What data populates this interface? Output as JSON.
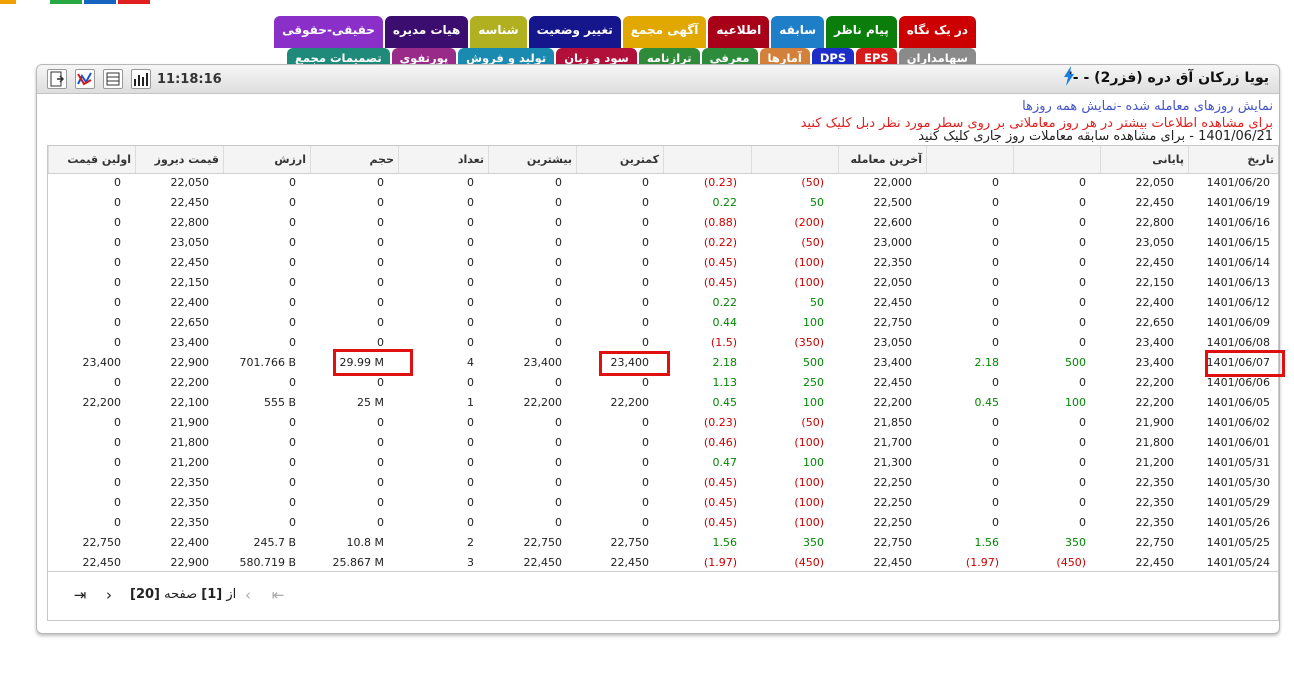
{
  "top_strip_colors": [
    "#f0a000",
    "#28a745",
    "#1565c0",
    "#e02020"
  ],
  "tabs_row1": [
    {
      "label": "در یک نگاه",
      "color": "#cc0000"
    },
    {
      "label": "پیام ناظر",
      "color": "#0a7d0a"
    },
    {
      "label": "سابقه",
      "color": "#1e7fc8"
    },
    {
      "label": "اطلاعیه",
      "color": "#a80018"
    },
    {
      "label": "آگهی مجمع",
      "color": "#e0a800"
    },
    {
      "label": "تغییر وضعیت",
      "color": "#16168c"
    },
    {
      "label": "شناسه",
      "color": "#b0b020"
    },
    {
      "label": "هیات مدیره",
      "color": "#3a0d6e"
    },
    {
      "label": "حقیقی-حقوقی",
      "color": "#8b2fc9"
    }
  ],
  "tabs_row2": [
    {
      "label": "سهامداران",
      "color": "#8a8a8a"
    },
    {
      "label": "EPS",
      "color": "#d61a1a"
    },
    {
      "label": "DPS",
      "color": "#1d2ec8"
    },
    {
      "label": "آمارها",
      "color": "#d2803a"
    },
    {
      "label": "معرفی",
      "color": "#2c8c3c"
    },
    {
      "label": "ترازنامه",
      "color": "#2f8a3a"
    },
    {
      "label": "سود و زیان",
      "color": "#b0103a"
    },
    {
      "label": "تولید و فروش",
      "color": "#1a8ab0"
    },
    {
      "label": "پورتفوی",
      "color": "#9a2a8a"
    },
    {
      "label": "تصمیمات مجمع",
      "color": "#1f8a7a"
    }
  ],
  "panel": {
    "title": "یویا زرکان آق دره (فزر2) - -'",
    "time": "11:18:16"
  },
  "info": {
    "line1": "نمایش روزهای معامله شده -نمایش همه روزها",
    "line2": "برای مشاهده اطلاعات بیشتر در هر روز معاملاتی بر روی سطر مورد نظر دبل کلیک کنید",
    "line3": "1401/06/21 - برای مشاهده سابقه معاملات روز جاری کلیک کنید"
  },
  "columns": [
    "تاریخ",
    "پایانی",
    "",
    "",
    "آخرین معامله",
    "",
    "",
    "کمترین",
    "بیشترین",
    "تعداد",
    "حجم",
    "ارزش",
    "قیمت دیروز",
    "اولین قیمت"
  ],
  "rows": [
    [
      "1401/06/20",
      "22,050",
      "0",
      "0",
      "22,000",
      "(50)",
      "(0.23)",
      "0",
      "0",
      "0",
      "0",
      "0",
      "22,050",
      "0"
    ],
    [
      "1401/06/19",
      "22,450",
      "0",
      "0",
      "22,500",
      "50",
      "0.22",
      "0",
      "0",
      "0",
      "0",
      "0",
      "22,450",
      "0"
    ],
    [
      "1401/06/16",
      "22,800",
      "0",
      "0",
      "22,600",
      "(200)",
      "(0.88)",
      "0",
      "0",
      "0",
      "0",
      "0",
      "22,800",
      "0"
    ],
    [
      "1401/06/15",
      "23,050",
      "0",
      "0",
      "23,000",
      "(50)",
      "(0.22)",
      "0",
      "0",
      "0",
      "0",
      "0",
      "23,050",
      "0"
    ],
    [
      "1401/06/14",
      "22,450",
      "0",
      "0",
      "22,350",
      "(100)",
      "(0.45)",
      "0",
      "0",
      "0",
      "0",
      "0",
      "22,450",
      "0"
    ],
    [
      "1401/06/13",
      "22,150",
      "0",
      "0",
      "22,050",
      "(100)",
      "(0.45)",
      "0",
      "0",
      "0",
      "0",
      "0",
      "22,150",
      "0"
    ],
    [
      "1401/06/12",
      "22,400",
      "0",
      "0",
      "22,450",
      "50",
      "0.22",
      "0",
      "0",
      "0",
      "0",
      "0",
      "22,400",
      "0"
    ],
    [
      "1401/06/09",
      "22,650",
      "0",
      "0",
      "22,750",
      "100",
      "0.44",
      "0",
      "0",
      "0",
      "0",
      "0",
      "22,650",
      "0"
    ],
    [
      "1401/06/08",
      "23,400",
      "0",
      "0",
      "23,050",
      "(350)",
      "(1.5)",
      "0",
      "0",
      "0",
      "0",
      "0",
      "23,400",
      "0"
    ],
    [
      "1401/06/07",
      "23,400",
      "500",
      "2.18",
      "23,400",
      "500",
      "2.18",
      "23,400",
      "23,400",
      "4",
      "29.99 M",
      "701.766 B",
      "22,900",
      "23,400"
    ],
    [
      "1401/06/06",
      "22,200",
      "0",
      "0",
      "22,450",
      "250",
      "1.13",
      "0",
      "0",
      "0",
      "0",
      "0",
      "22,200",
      "0"
    ],
    [
      "1401/06/05",
      "22,200",
      "100",
      "0.45",
      "22,200",
      "100",
      "0.45",
      "22,200",
      "22,200",
      "1",
      "25 M",
      "555 B",
      "22,100",
      "22,200"
    ],
    [
      "1401/06/02",
      "21,900",
      "0",
      "0",
      "21,850",
      "(50)",
      "(0.23)",
      "0",
      "0",
      "0",
      "0",
      "0",
      "21,900",
      "0"
    ],
    [
      "1401/06/01",
      "21,800",
      "0",
      "0",
      "21,700",
      "(100)",
      "(0.46)",
      "0",
      "0",
      "0",
      "0",
      "0",
      "21,800",
      "0"
    ],
    [
      "1401/05/31",
      "21,200",
      "0",
      "0",
      "21,300",
      "100",
      "0.47",
      "0",
      "0",
      "0",
      "0",
      "0",
      "21,200",
      "0"
    ],
    [
      "1401/05/30",
      "22,350",
      "0",
      "0",
      "22,250",
      "(100)",
      "(0.45)",
      "0",
      "0",
      "0",
      "0",
      "0",
      "22,350",
      "0"
    ],
    [
      "1401/05/29",
      "22,350",
      "0",
      "0",
      "22,250",
      "(100)",
      "(0.45)",
      "0",
      "0",
      "0",
      "0",
      "0",
      "22,350",
      "0"
    ],
    [
      "1401/05/26",
      "22,350",
      "0",
      "0",
      "22,250",
      "(100)",
      "(0.45)",
      "0",
      "0",
      "0",
      "0",
      "0",
      "22,350",
      "0"
    ],
    [
      "1401/05/25",
      "22,750",
      "350",
      "1.56",
      "22,750",
      "350",
      "1.56",
      "22,750",
      "22,750",
      "2",
      "10.8 M",
      "245.7 B",
      "22,400",
      "22,750"
    ],
    [
      "1401/05/24",
      "22,450",
      "(450)",
      "(1.97)",
      "22,450",
      "(450)",
      "(1.97)",
      "22,450",
      "22,450",
      "3",
      "25.867 M",
      "580.719 B",
      "22,900",
      "22,450"
    ]
  ],
  "pager": {
    "page_word": "صفحه",
    "current": "[1]",
    "of_word": "از",
    "total": "[20]"
  },
  "icons": [
    "bolt-icon",
    "chart-bars-icon",
    "table-icon",
    "network-chart-icon",
    "export-icon",
    "first-page-icon",
    "prev-page-icon",
    "next-page-icon",
    "last-page-icon"
  ],
  "colors": {
    "negative": "#cc0000",
    "positive": "#008800",
    "highlight": "#e01010",
    "info_blue": "#4455cc",
    "info_red": "#e02020"
  }
}
